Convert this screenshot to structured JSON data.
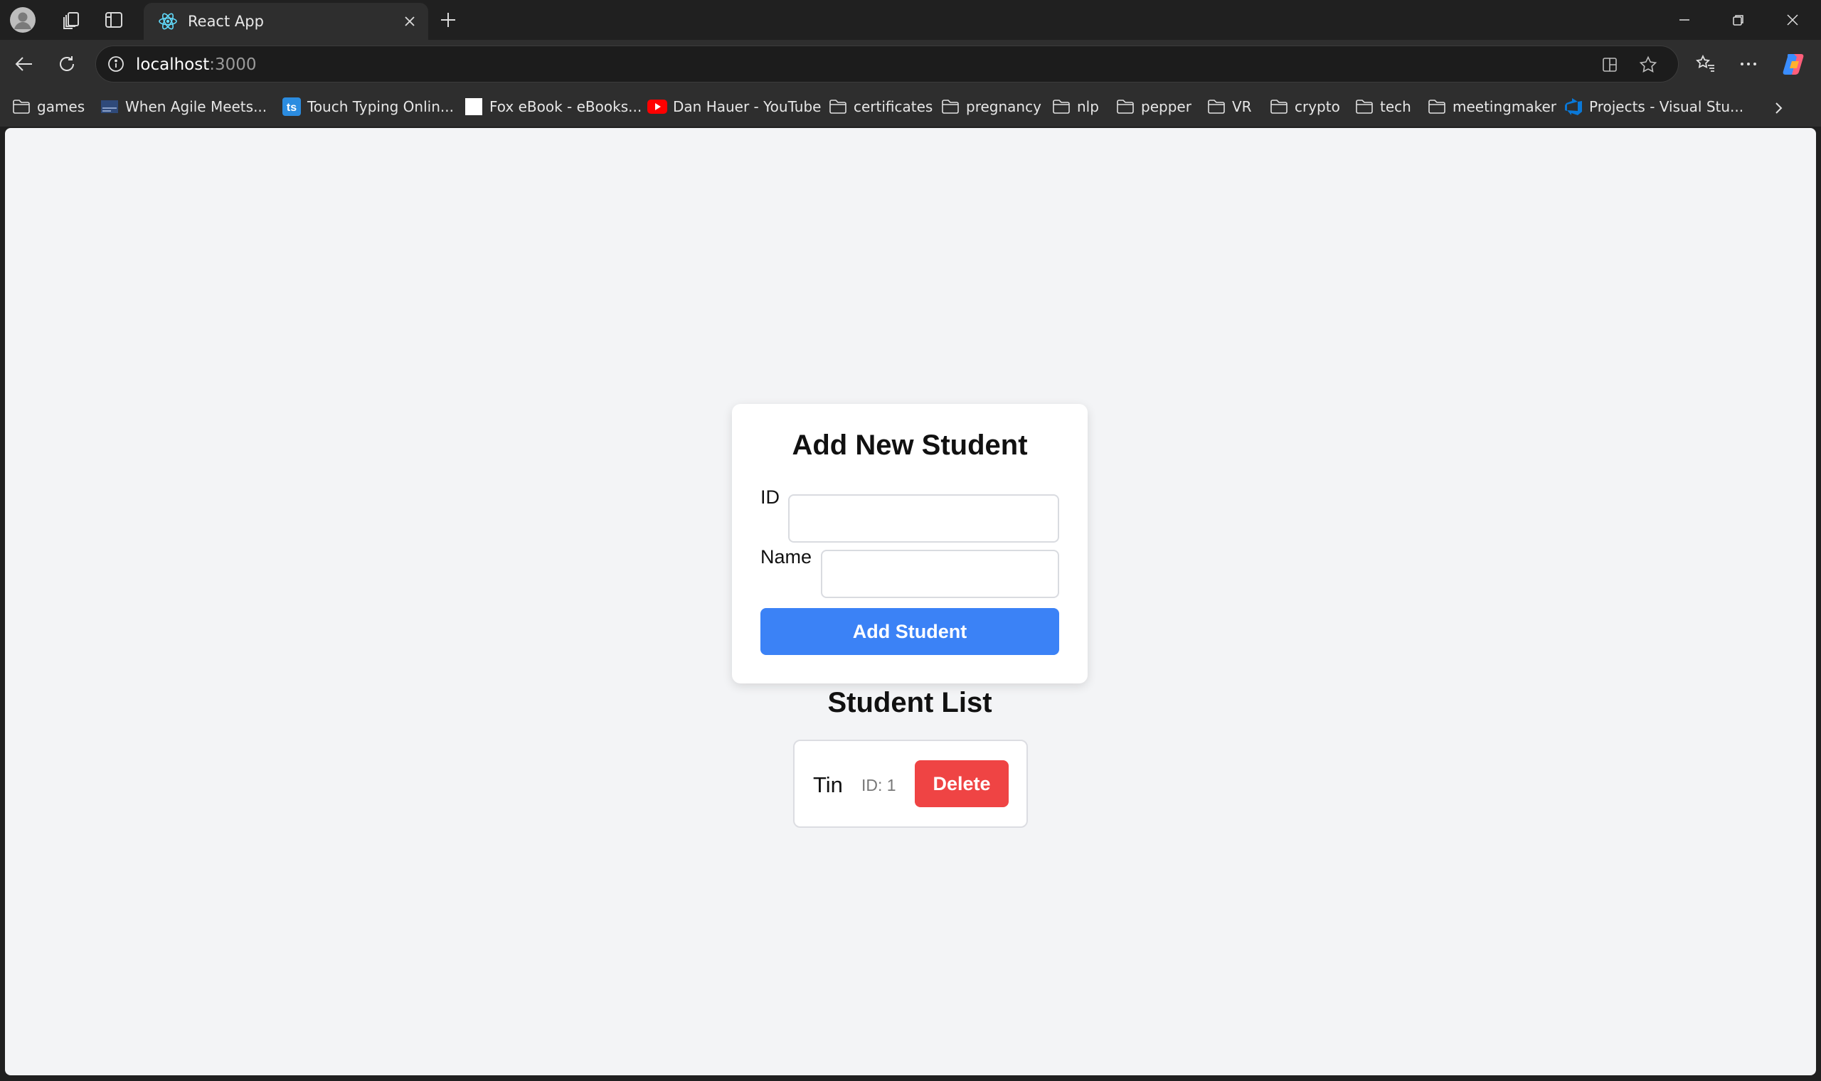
{
  "browser": {
    "tab": {
      "title": "React App"
    },
    "address": {
      "host": "localhost",
      "port": ":3000"
    },
    "bookmarks": [
      {
        "label": "games",
        "icon": "folder-icon"
      },
      {
        "label": "When Agile Meets...",
        "icon": "page-thumbnail-icon"
      },
      {
        "label": "Touch Typing Onlin...",
        "icon": "ts-logo-icon"
      },
      {
        "label": "Fox eBook - eBooks...",
        "icon": "blank-page-icon"
      },
      {
        "label": "Dan Hauer - YouTube",
        "icon": "youtube-icon"
      },
      {
        "label": "certificates",
        "icon": "folder-icon"
      },
      {
        "label": "pregnancy",
        "icon": "folder-icon"
      },
      {
        "label": "nlp",
        "icon": "folder-icon"
      },
      {
        "label": "pepper",
        "icon": "folder-icon"
      },
      {
        "label": "VR",
        "icon": "folder-icon"
      },
      {
        "label": "crypto",
        "icon": "folder-icon"
      },
      {
        "label": "tech",
        "icon": "folder-icon"
      },
      {
        "label": "meetingmaker",
        "icon": "folder-icon"
      },
      {
        "label": "Projects - Visual Stu...",
        "icon": "azure-devops-icon"
      }
    ]
  },
  "form": {
    "title": "Add New Student",
    "id_label": "ID",
    "id_value": "",
    "name_label": "Name",
    "name_value": "",
    "submit_label": "Add Student"
  },
  "list": {
    "title": "Student List",
    "students": [
      {
        "name": "Tin",
        "id_text": "ID: 1",
        "delete_label": "Delete"
      }
    ]
  },
  "colors": {
    "primary": "#3b82f6",
    "danger": "#ef4444",
    "page_background": "#f3f4f6"
  }
}
